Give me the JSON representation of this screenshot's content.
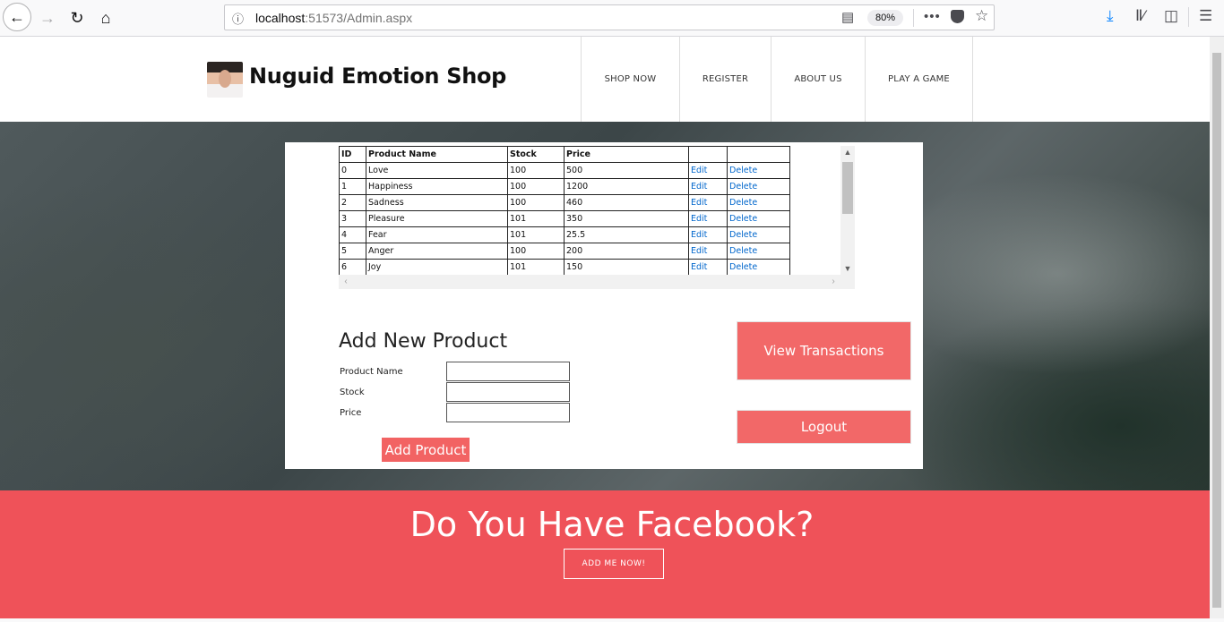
{
  "browser": {
    "url_host": "localhost",
    "url_path": ":51573/Admin.aspx",
    "zoom": "80%"
  },
  "site": {
    "title": "Nuguid Emotion Shop",
    "nav": [
      "SHOP NOW",
      "REGISTER",
      "ABOUT US",
      "PLAY A GAME"
    ]
  },
  "grid": {
    "headers": [
      "ID",
      "Product Name",
      "Stock",
      "Price",
      "",
      ""
    ],
    "edit_label": "Edit",
    "delete_label": "Delete",
    "rows": [
      [
        "0",
        "Love",
        "100",
        "500"
      ],
      [
        "1",
        "Happiness",
        "100",
        "1200"
      ],
      [
        "2",
        "Sadness",
        "100",
        "460"
      ],
      [
        "3",
        "Pleasure",
        "101",
        "350"
      ],
      [
        "4",
        "Fear",
        "101",
        "25.5"
      ],
      [
        "5",
        "Anger",
        "100",
        "200"
      ],
      [
        "6",
        "Joy",
        "101",
        "150"
      ]
    ]
  },
  "form": {
    "title": "Add New Product",
    "product_name_label": "Product Name",
    "stock_label": "Stock",
    "price_label": "Price",
    "product_name_value": "",
    "stock_value": "",
    "price_value": "",
    "submit_label": "Add Product"
  },
  "actions": {
    "view_transactions": "View Transactions",
    "logout": "Logout"
  },
  "footer": {
    "title": "Do You Have Facebook?",
    "button": "ADD ME NOW!"
  },
  "colors": {
    "accent": "#f26868",
    "footer_bg": "#ef5259",
    "link": "#0066cc"
  }
}
